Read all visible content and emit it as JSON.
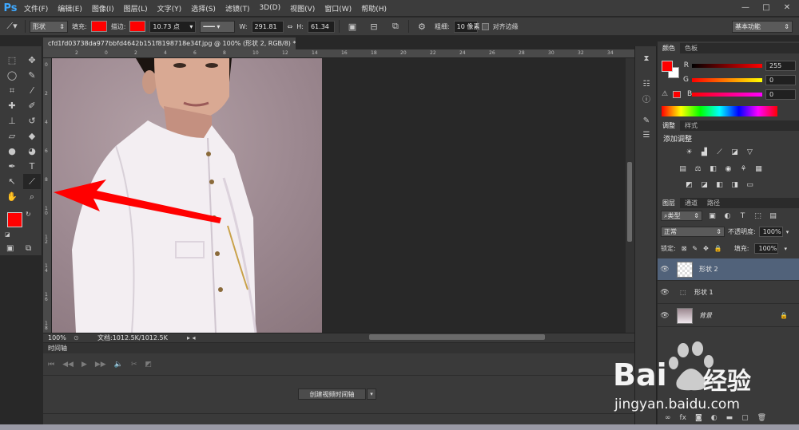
{
  "app": {
    "logo": "Ps",
    "window_controls": [
      "—",
      "□",
      "✕"
    ]
  },
  "menu": [
    "文件(F)",
    "编辑(E)",
    "图像(I)",
    "图层(L)",
    "文字(Y)",
    "选择(S)",
    "滤镜(T)",
    "3D(D)",
    "视图(V)",
    "窗口(W)",
    "帮助(H)"
  ],
  "options_bar": {
    "tool_mode": "形状",
    "fill_label": "填充:",
    "stroke_label": "描边:",
    "stroke_width": "10.73 点",
    "w_label": "W:",
    "w_value": "291.81",
    "h_label": "H:",
    "h_value": "61.34",
    "weight_label": "粗细:",
    "weight_value": "10 像素",
    "align_edges": "对齐边缘",
    "workspace": "基本功能",
    "fill_color": "#ff0000",
    "stroke_color": "#ff0000"
  },
  "document": {
    "tab_title": "cfd1fd03738da977bbfd4642b151f8198718e34f.jpg @ 100% (形状 2, RGB/8) *",
    "close": "×",
    "ruler_top_ticks": [
      "2",
      "0",
      "2",
      "4",
      "6",
      "8",
      "10",
      "12",
      "14",
      "16",
      "18",
      "20",
      "22",
      "24",
      "26",
      "28",
      "30",
      "32",
      "34"
    ],
    "ruler_left_ticks": [
      "0",
      "2",
      "4",
      "6",
      "8",
      "1 0",
      "1 2",
      "1 4",
      "1 6",
      "1 8"
    ]
  },
  "statusbar": {
    "zoom": "100%",
    "doc_info": "文档:1012.5K/1012.5K"
  },
  "timeline": {
    "tab": "时间轴",
    "create_button": "创建视频时间轴",
    "dropdown": "▾"
  },
  "color_panel": {
    "tabs": [
      "颜色",
      "色板"
    ],
    "r_label": "R",
    "r_value": "255",
    "g_label": "G",
    "g_value": "0",
    "b_label": "B",
    "b_value": "0",
    "fg": "#ff0000"
  },
  "adjust_panel": {
    "tabs": [
      "调整",
      "样式"
    ],
    "title": "添加调整"
  },
  "layers_panel": {
    "tabs": [
      "图层",
      "通道",
      "路径"
    ],
    "filter": "类型",
    "blend_mode": "正常",
    "opacity_label": "不透明度:",
    "opacity": "100%",
    "lock_label": "锁定:",
    "fill_label": "填充:",
    "fill": "100%",
    "layers": [
      {
        "name": "形状 2",
        "selected": true
      },
      {
        "name": "形状 1",
        "selected": false
      },
      {
        "name": "背景",
        "selected": false
      }
    ]
  },
  "watermark": {
    "brand": "Bai",
    "brand_cn": "经验",
    "url": "jingyan.baidu.com"
  }
}
